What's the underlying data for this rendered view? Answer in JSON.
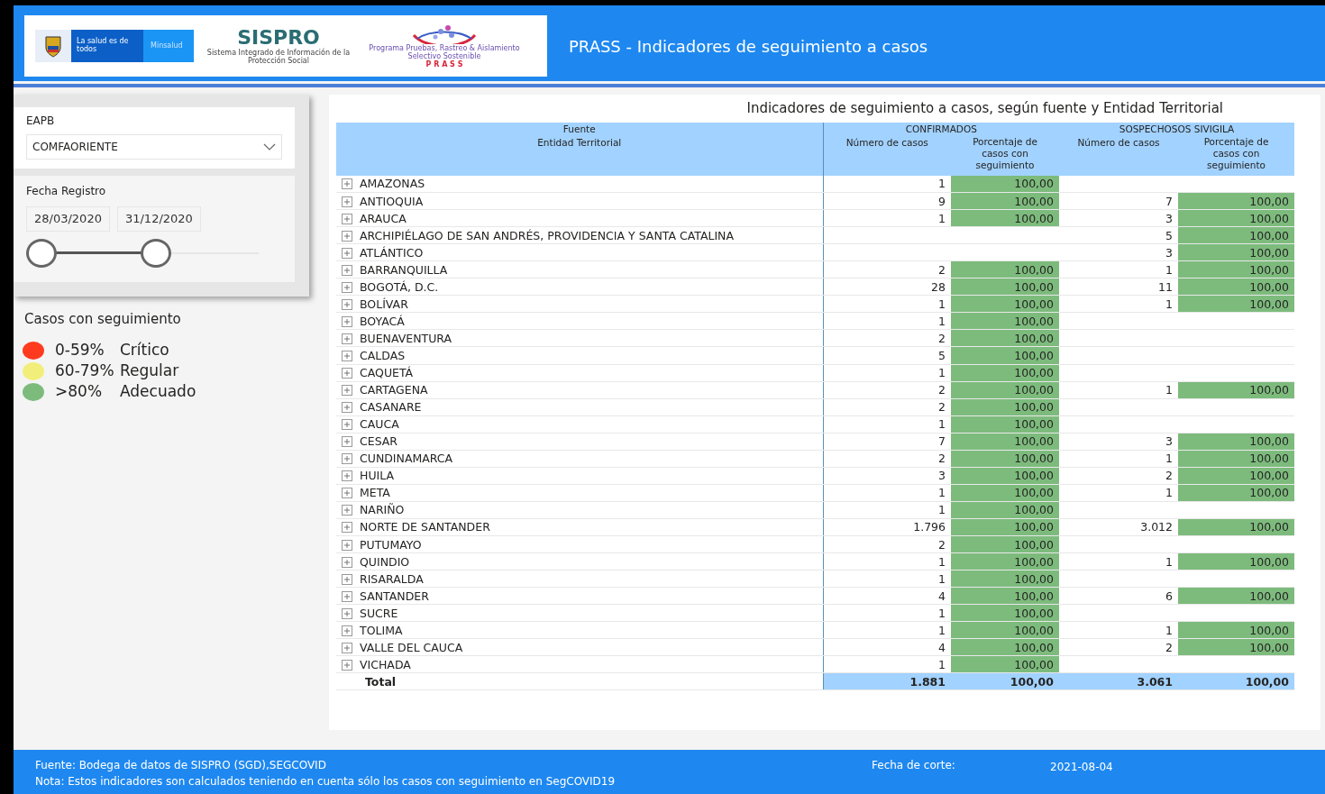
{
  "header": {
    "logo_minsalud": {
      "slogan": "La salud es de todos",
      "name": "Minsalud"
    },
    "logo_sispro": {
      "name": "SISPRO",
      "subtitle": "Sistema Integrado de Información de la Protección Social"
    },
    "logo_prass": {
      "subtitle": "Programa Pruebas, Rastreo & Aislamiento Selectivo Sostenible",
      "name": "P R A S S"
    },
    "title": "PRASS - Indicadores de seguimiento a casos"
  },
  "filters": {
    "eapb": {
      "label": "EAPB",
      "value": "COMFAORIENTE"
    },
    "fecha": {
      "label": "Fecha Registro",
      "start": "28/03/2020",
      "end": "31/12/2020",
      "thumbs": [
        {
          "level": 0
        },
        {
          "level": 0.53
        }
      ]
    }
  },
  "legend": {
    "title": "Casos con seguimiento",
    "items": [
      {
        "range": "0-59%",
        "label": "Crítico",
        "color": "#ff3b1f"
      },
      {
        "range": "60-79%",
        "label": "Regular",
        "color": "#f2ee7a"
      },
      {
        "range": ">80%",
        "label": "Adecuado",
        "color": "#7dbb7d"
      }
    ]
  },
  "table": {
    "title": "Indicadores de seguimiento a casos, según fuente y Entidad Territorial",
    "header_row_1": [
      "Fuente",
      "CONFIRMADOS",
      "SOSPECHOSOS SIVIGILA"
    ],
    "header_row_2": [
      "Entidad Territorial",
      "Número de casos",
      "Porcentaje de casos con seguimiento",
      "Número de casos",
      "Porcentaje de casos con seguimiento"
    ],
    "rows": [
      {
        "name": "AMAZONAS",
        "expanded": false,
        "c_n": "1",
        "c_p": "100,00",
        "s_n": "",
        "s_p": ""
      },
      {
        "name": "ANTIOQUIA",
        "expanded": false,
        "c_n": "9",
        "c_p": "100,00",
        "s_n": "7",
        "s_p": "100,00"
      },
      {
        "name": "ARAUCA",
        "expanded": false,
        "c_n": "1",
        "c_p": "100,00",
        "s_n": "3",
        "s_p": "100,00"
      },
      {
        "name": "ARCHIPIÉLAGO DE SAN ANDRÉS, PROVIDENCIA Y SANTA CATALINA",
        "expanded": false,
        "c_n": "",
        "c_p": "",
        "s_n": "5",
        "s_p": "100,00"
      },
      {
        "name": "ATLÁNTICO",
        "expanded": false,
        "c_n": "",
        "c_p": "",
        "s_n": "3",
        "s_p": "100,00"
      },
      {
        "name": "BARRANQUILLA",
        "expanded": false,
        "c_n": "2",
        "c_p": "100,00",
        "s_n": "1",
        "s_p": "100,00"
      },
      {
        "name": "BOGOTÁ, D.C.",
        "expanded": false,
        "c_n": "28",
        "c_p": "100,00",
        "s_n": "11",
        "s_p": "100,00"
      },
      {
        "name": "BOLÍVAR",
        "expanded": false,
        "c_n": "1",
        "c_p": "100,00",
        "s_n": "1",
        "s_p": "100,00"
      },
      {
        "name": "BOYACÁ",
        "expanded": false,
        "c_n": "1",
        "c_p": "100,00",
        "s_n": "",
        "s_p": ""
      },
      {
        "name": "BUENAVENTURA",
        "expanded": false,
        "c_n": "2",
        "c_p": "100,00",
        "s_n": "",
        "s_p": ""
      },
      {
        "name": "CALDAS",
        "expanded": false,
        "c_n": "5",
        "c_p": "100,00",
        "s_n": "",
        "s_p": ""
      },
      {
        "name": "CAQUETÁ",
        "expanded": false,
        "c_n": "1",
        "c_p": "100,00",
        "s_n": "",
        "s_p": ""
      },
      {
        "name": "CARTAGENA",
        "expanded": false,
        "c_n": "2",
        "c_p": "100,00",
        "s_n": "1",
        "s_p": "100,00"
      },
      {
        "name": "CASANARE",
        "expanded": false,
        "c_n": "2",
        "c_p": "100,00",
        "s_n": "",
        "s_p": ""
      },
      {
        "name": "CAUCA",
        "expanded": false,
        "c_n": "1",
        "c_p": "100,00",
        "s_n": "",
        "s_p": ""
      },
      {
        "name": "CESAR",
        "expanded": false,
        "c_n": "7",
        "c_p": "100,00",
        "s_n": "3",
        "s_p": "100,00"
      },
      {
        "name": "CUNDINAMARCA",
        "expanded": false,
        "c_n": "2",
        "c_p": "100,00",
        "s_n": "1",
        "s_p": "100,00"
      },
      {
        "name": "HUILA",
        "expanded": false,
        "c_n": "3",
        "c_p": "100,00",
        "s_n": "2",
        "s_p": "100,00"
      },
      {
        "name": "META",
        "expanded": false,
        "c_n": "1",
        "c_p": "100,00",
        "s_n": "1",
        "s_p": "100,00"
      },
      {
        "name": "NARIÑO",
        "expanded": false,
        "c_n": "1",
        "c_p": "100,00",
        "s_n": "",
        "s_p": ""
      },
      {
        "name": "NORTE DE SANTANDER",
        "expanded": false,
        "c_n": "1.796",
        "c_p": "100,00",
        "s_n": "3.012",
        "s_p": "100,00"
      },
      {
        "name": "PUTUMAYO",
        "expanded": false,
        "c_n": "2",
        "c_p": "100,00",
        "s_n": "",
        "s_p": ""
      },
      {
        "name": "QUINDIO",
        "expanded": false,
        "c_n": "1",
        "c_p": "100,00",
        "s_n": "1",
        "s_p": "100,00"
      },
      {
        "name": "RISARALDA",
        "expanded": false,
        "c_n": "1",
        "c_p": "100,00",
        "s_n": "",
        "s_p": ""
      },
      {
        "name": "SANTANDER",
        "expanded": false,
        "c_n": "4",
        "c_p": "100,00",
        "s_n": "6",
        "s_p": "100,00"
      },
      {
        "name": "SUCRE",
        "expanded": false,
        "c_n": "1",
        "c_p": "100,00",
        "s_n": "",
        "s_p": ""
      },
      {
        "name": "TOLIMA",
        "expanded": false,
        "c_n": "1",
        "c_p": "100,00",
        "s_n": "1",
        "s_p": "100,00"
      },
      {
        "name": "VALLE DEL CAUCA",
        "expanded": false,
        "c_n": "4",
        "c_p": "100,00",
        "s_n": "2",
        "s_p": "100,00"
      },
      {
        "name": "VICHADA",
        "expanded": false,
        "c_n": "1",
        "c_p": "100,00",
        "s_n": "",
        "s_p": ""
      }
    ],
    "total": {
      "name": "Total",
      "c_n": "1.881",
      "c_p": "100,00",
      "s_n": "3.061",
      "s_p": "100,00"
    }
  },
  "footer": {
    "source": "Fuente: Bodega de datos de SISPRO (SGD),SEGCOVID",
    "note": "Nota: Estos indicadores son calculados teniendo en cuenta sólo los casos con seguimiento en SegCOVID19",
    "cut_label": "Fecha de corte:",
    "cut_date": "2021-08-04"
  }
}
